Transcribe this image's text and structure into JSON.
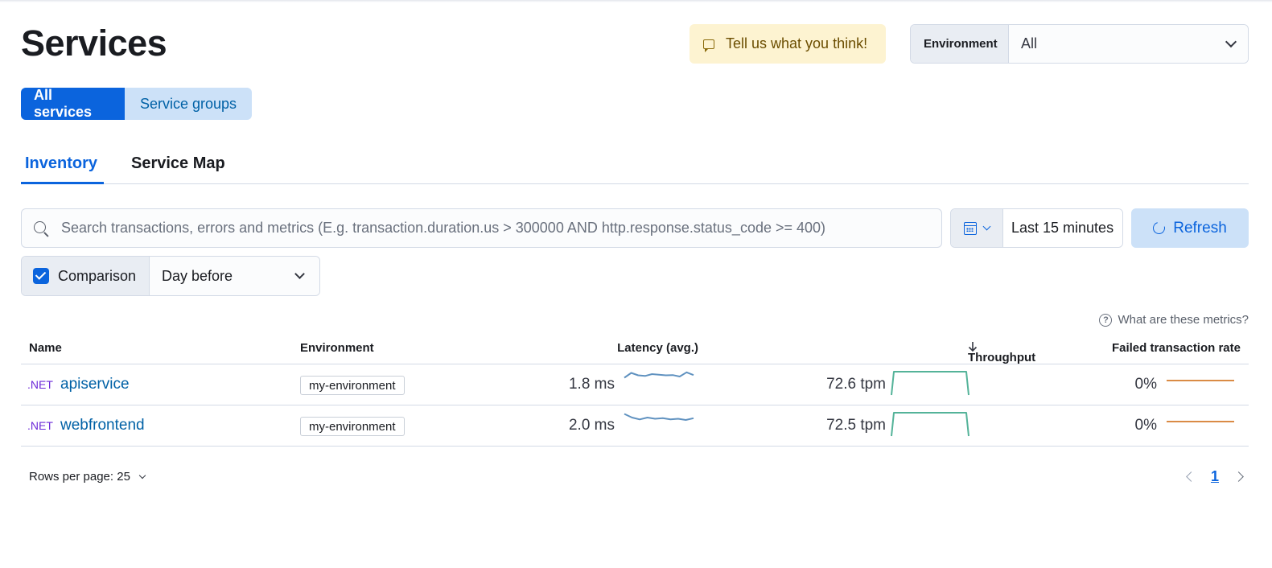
{
  "page": {
    "title": "Services"
  },
  "feedback": {
    "label": "Tell us what you think!",
    "icon": "chat-bubble-icon"
  },
  "environment_selector": {
    "label": "Environment",
    "value": "All"
  },
  "view_toggle": {
    "all_services": "All services",
    "service_groups": "Service groups",
    "active": "All services"
  },
  "tabs": [
    {
      "label": "Inventory",
      "selected": true
    },
    {
      "label": "Service Map",
      "selected": false
    }
  ],
  "search": {
    "placeholder": "Search transactions, errors and metrics (E.g. transaction.duration.us > 300000 AND http.response.status_code >= 400)",
    "value": ""
  },
  "date_picker": {
    "range": "Last 15 minutes"
  },
  "refresh": {
    "label": "Refresh"
  },
  "comparison": {
    "label": "Comparison",
    "checked": true,
    "value": "Day before"
  },
  "metrics_help": {
    "label": "What are these metrics?"
  },
  "table": {
    "columns": {
      "name": "Name",
      "environment": "Environment",
      "latency": "Latency (avg.)",
      "throughput": "Throughput",
      "failed_rate": "Failed transaction rate"
    },
    "sort_column": "Throughput",
    "sort_direction": "descending",
    "rows": [
      {
        "agent": ".NET",
        "name": "apiservice",
        "environment": "my-environment",
        "latency": "1.8 ms",
        "throughput": "72.6 tpm",
        "failed_rate": "0%",
        "latency_trend": [
          0.5,
          0.9,
          0.7,
          0.65,
          0.8,
          0.75,
          0.7,
          0.72,
          0.6,
          0.95,
          0.72
        ],
        "throughput_trend": [
          0.0,
          1.0,
          1.0,
          1.0,
          1.0,
          1.0,
          1.0,
          0.0
        ],
        "failed_trend": [
          0,
          0,
          0,
          0,
          0,
          0,
          0
        ]
      },
      {
        "agent": ".NET",
        "name": "webfrontend",
        "environment": "my-environment",
        "latency": "2.0 ms",
        "throughput": "72.5 tpm",
        "failed_rate": "0%",
        "latency_trend": [
          0.9,
          0.6,
          0.45,
          0.6,
          0.5,
          0.55,
          0.45,
          0.5,
          0.4,
          0.55
        ],
        "throughput_trend": [
          0.0,
          1.0,
          1.0,
          1.0,
          1.0,
          1.0,
          1.0,
          0.0
        ],
        "failed_trend": [
          0,
          0,
          0,
          0,
          0,
          0,
          0
        ]
      }
    ]
  },
  "pagination": {
    "rows_per_page_label": "Rows per page: 25",
    "current_page": "1"
  },
  "colors": {
    "primary": "#0b64dd",
    "latency_spark": "#6092c0",
    "throughput_spark": "#54b399",
    "failed_spark": "#da8b45",
    "agent_dotnet": "#6d2ad8",
    "feedback_bg": "#fdf3d1"
  }
}
